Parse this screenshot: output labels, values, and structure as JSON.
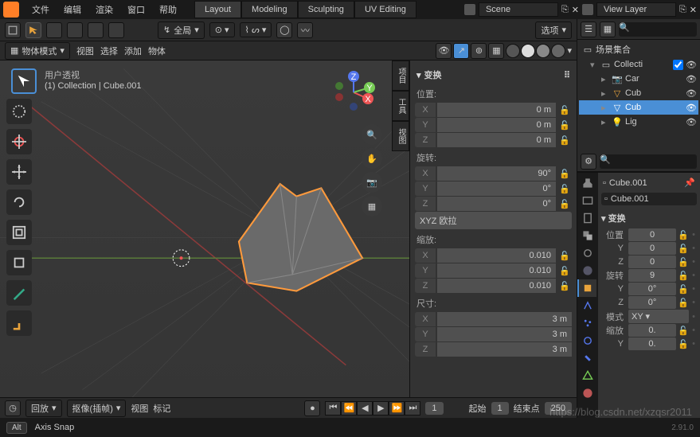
{
  "menu": [
    "文件",
    "编辑",
    "渲染",
    "窗口",
    "帮助"
  ],
  "workspaces": [
    "Layout",
    "Modeling",
    "Sculpting",
    "UV Editing"
  ],
  "active_workspace": "Layout",
  "scene_label": "Scene",
  "layer_label": "View Layer",
  "vp_header": {
    "global": "全局",
    "options": "选项"
  },
  "vp_header2": {
    "mode": "物体模式",
    "menus": [
      "视图",
      "选择",
      "添加",
      "物体"
    ]
  },
  "overlay": {
    "line1": "用户透视",
    "line2": "(1) Collection | Cube.001"
  },
  "npanel": {
    "title": "变换",
    "position": {
      "label": "位置:",
      "rows": [
        {
          "a": "X",
          "v": "0 m"
        },
        {
          "a": "Y",
          "v": "0 m"
        },
        {
          "a": "Z",
          "v": "0 m"
        }
      ]
    },
    "rotation": {
      "label": "旋转:",
      "rows": [
        {
          "a": "X",
          "v": "90°"
        },
        {
          "a": "Y",
          "v": "0°"
        },
        {
          "a": "Z",
          "v": "0°"
        }
      ],
      "mode": "XYZ 欧拉"
    },
    "scale": {
      "label": "缩放:",
      "rows": [
        {
          "a": "X",
          "v": "0.010"
        },
        {
          "a": "Y",
          "v": "0.010"
        },
        {
          "a": "Z",
          "v": "0.010"
        }
      ]
    },
    "dim": {
      "label": "尺寸:",
      "rows": [
        {
          "a": "X",
          "v": "3 m"
        },
        {
          "a": "Y",
          "v": "3 m"
        },
        {
          "a": "Z",
          "v": "3 m"
        }
      ]
    }
  },
  "side_tabs": [
    "项目",
    "工具",
    "视图"
  ],
  "outliner": {
    "root": "场景集合",
    "collection": "Collecti",
    "items": [
      {
        "icon": "camera",
        "name": "Car"
      },
      {
        "icon": "mesh",
        "name": "Cub"
      },
      {
        "icon": "mesh",
        "name": "Cub",
        "sel": true
      },
      {
        "icon": "light",
        "name": "Lig"
      }
    ]
  },
  "props": {
    "obj": "Cube.001",
    "data": "Cube.001",
    "panel": "变换",
    "pos_label": "位置",
    "pos": {
      "x": "0"
    },
    "y_label": "Y",
    "y": "0",
    "z_label": "Z",
    "z": "0",
    "rot_label": "旋转",
    "rot": "9",
    "ry": "0°",
    "rz": "0°",
    "mode_label": "模式",
    "mode": "XY",
    "scale_label": "缩放",
    "scale": "0.",
    "sy": "0."
  },
  "timeline": {
    "playback": "回放",
    "keying": "抠像(插帧)",
    "view": "视图",
    "marker": "标记",
    "frame": "1",
    "start_label": "起始",
    "start": "1",
    "end_label": "结束点",
    "end": "250"
  },
  "status": {
    "key": "Alt",
    "hint": "Axis Snap",
    "version": "2.91.0"
  },
  "watermark": "https://blog.csdn.net/xzqsr2011"
}
